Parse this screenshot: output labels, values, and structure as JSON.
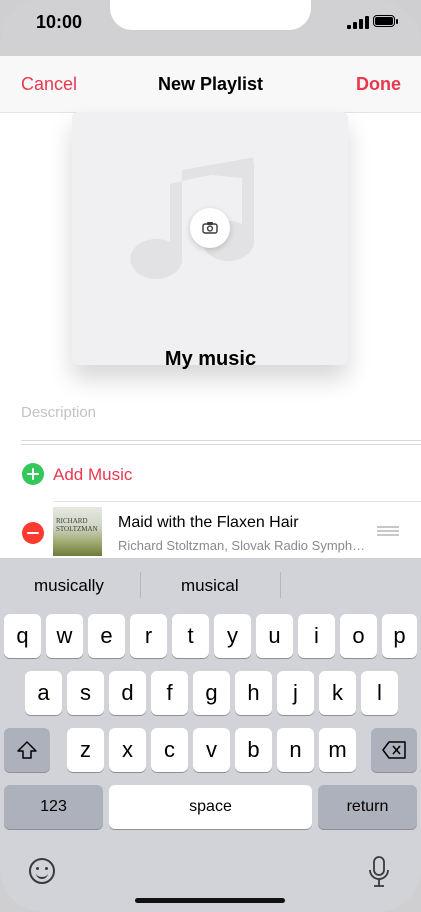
{
  "status_bar": {
    "time": "10:00"
  },
  "nav": {
    "cancel": "Cancel",
    "title": "New Playlist",
    "done": "Done"
  },
  "playlist": {
    "name": "My music",
    "description_placeholder": "Description",
    "add_music": "Add Music"
  },
  "songs": [
    {
      "title": "Maid with the Flaxen Hair",
      "artist": "Richard Stoltzman, Slovak Radio Symph…",
      "art_text_1": "RICHARD STOLTZMAN",
      "art_text_2": ""
    }
  ],
  "keyboard": {
    "suggestions": [
      "musically",
      "musical",
      ""
    ],
    "row1": [
      "q",
      "w",
      "e",
      "r",
      "t",
      "y",
      "u",
      "i",
      "o",
      "p"
    ],
    "row2": [
      "a",
      "s",
      "d",
      "f",
      "g",
      "h",
      "j",
      "k",
      "l"
    ],
    "row3": [
      "z",
      "x",
      "c",
      "v",
      "b",
      "n",
      "m"
    ],
    "numbers_key": "123",
    "space_key": "space",
    "return_key": "return"
  },
  "colors": {
    "accent": "#e8384f",
    "add_green": "#34c759",
    "remove_red": "#ff3b30",
    "keyboard_bg": "#d1d3d9"
  },
  "icons": [
    "camera-icon",
    "music-note-icon",
    "add-icon",
    "remove-icon",
    "reorder-handle-icon",
    "shift-icon",
    "backspace-icon",
    "emoji-icon",
    "microphone-icon",
    "signal-icon",
    "battery-icon"
  ]
}
